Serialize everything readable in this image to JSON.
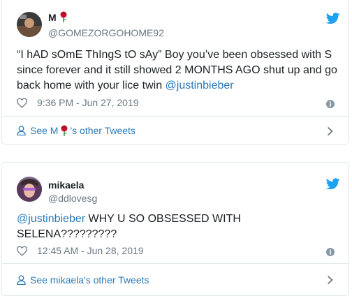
{
  "tweet1": {
    "display_name": "M",
    "handle": "@GOMEZORGOHOME92",
    "text_a": "“I hAD sOmE ThIngS tO sAy” Boy you’ve been obsessed with S since forever and it still showed 2 MONTHS AGO shut up and go back home with your lice twin ",
    "text_mention": "@justinbieber",
    "timestamp": "9:36 PM - Jun 27, 2019",
    "footer_prefix": "See M",
    "footer_suffix": "'s other Tweets"
  },
  "tweet2": {
    "display_name": "mikaela",
    "handle": "@ddlovesg",
    "text_mention": "@justinbieber",
    "text_b": " WHY U SO OBSESSED WITH SELENA?????????",
    "timestamp": "12:45 AM - Jun 28, 2019",
    "footer": "See mikaela's other Tweets"
  },
  "colors": {
    "link": "#2b7bb9",
    "muted": "#697882",
    "twitter_blue": "#1da1f2",
    "border": "#e1e8ed"
  }
}
